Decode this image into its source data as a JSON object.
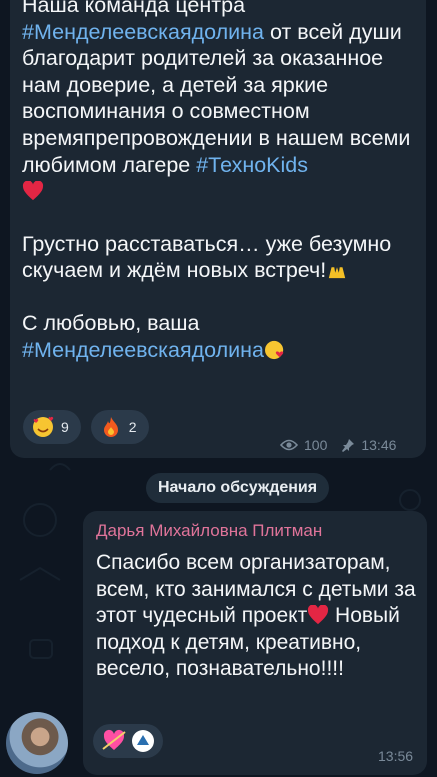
{
  "message1": {
    "line1": "Наша команда центра",
    "hashtag1": "#Менделеевскаядолина",
    "line2": " от всей души благодарит родителей за оказанное нам доверие, а детей за яркие воспоминания о совместном времяпрепровождении в нашем всеми любимом лагере ",
    "hashtag2": "#ТехноKids",
    "para2": "Грустно расставаться… уже безумно скучаем и ждём новых встреч!",
    "para3": "С любовью, ваша",
    "hashtag3": "#Менделеевскаядолина",
    "reactions": [
      {
        "icon": "hearts-face-emoji",
        "count": "9"
      },
      {
        "icon": "fire-emoji",
        "count": "2"
      }
    ],
    "views": "100",
    "time": "13:46"
  },
  "service": {
    "label": "Начало обсуждения"
  },
  "message2": {
    "author": "Дарья Михайловна Плитман",
    "text_part1": "Спасибо всем организаторам, всем, кто занимался с детьми за этот чудесный проект",
    "text_part2": " Новый подход к детям, креативно, весело, познавательно!!!!",
    "time": "13:56"
  }
}
